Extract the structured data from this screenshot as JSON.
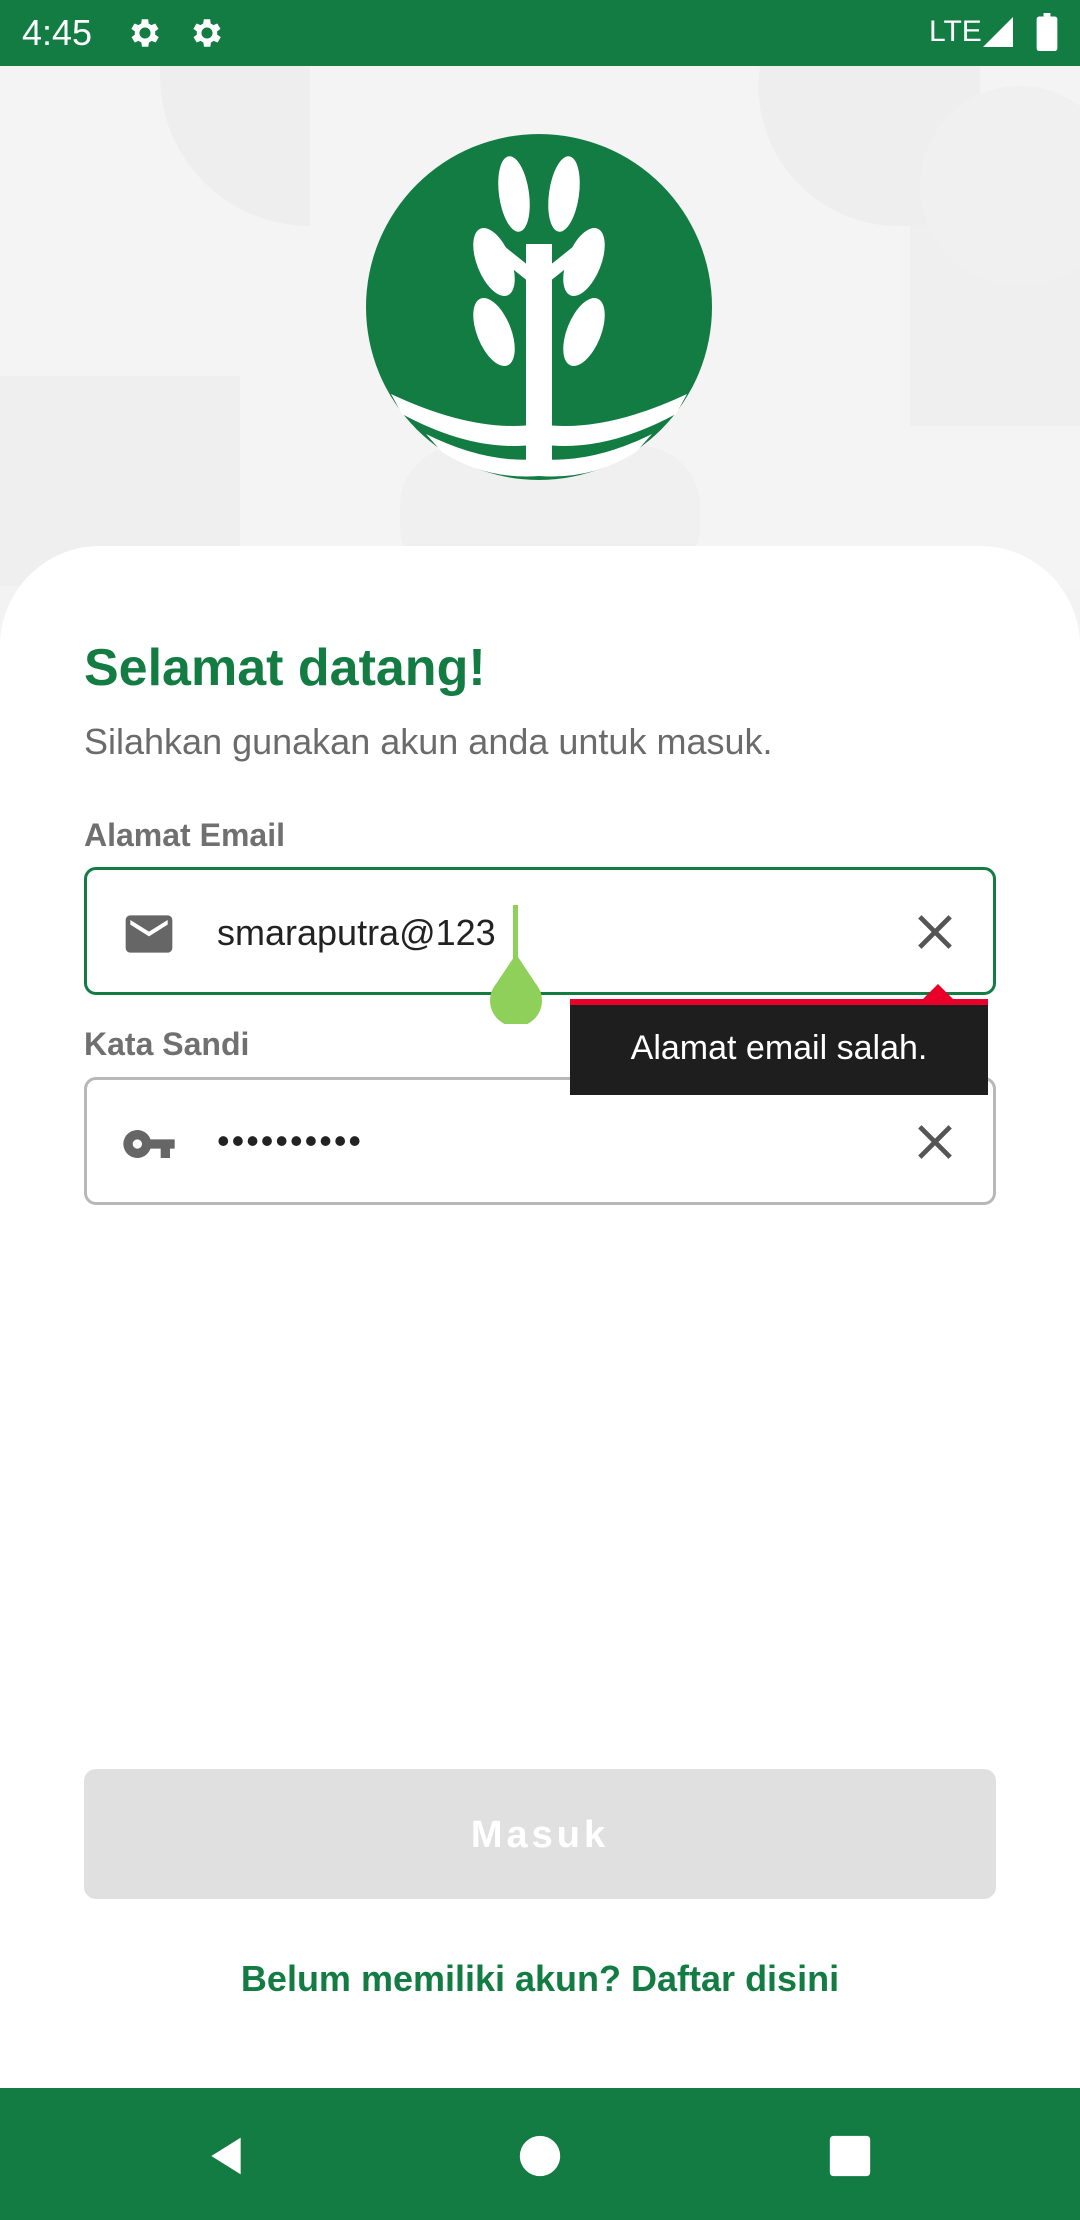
{
  "status_bar": {
    "time": "4:45",
    "network": "LTE",
    "icons": [
      "gear-icon",
      "gear-icon",
      "signal-icon",
      "battery-icon"
    ]
  },
  "brand": {
    "logo_icon": "wheat-plant-logo",
    "primary_color": "#137c43"
  },
  "login": {
    "title": "Selamat datang!",
    "subtitle": "Silahkan gunakan akun anda untuk masuk.",
    "email": {
      "label": "Alamat Email",
      "value": "smaraputra@123",
      "icon": "mail-icon",
      "clear_icon": "close-icon",
      "error": "Alamat email salah.",
      "error_color": "#e8002a"
    },
    "password": {
      "label": "Kata Sandi",
      "value": "••••••••••",
      "icon": "key-icon",
      "clear_icon": "close-icon"
    },
    "submit_label": "Masuk",
    "submit_enabled": false,
    "register_link": "Belum memiliki akun? Daftar disini"
  },
  "nav_bar": {
    "buttons": [
      "back-icon",
      "home-icon",
      "recents-icon"
    ]
  }
}
